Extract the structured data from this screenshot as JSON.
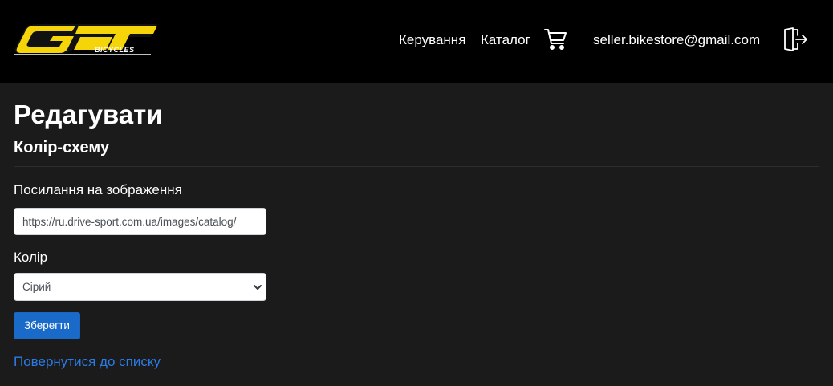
{
  "header": {
    "logo_text": "GT",
    "logo_subtext": "BICYCLES",
    "nav_manage": "Керування",
    "nav_catalog": "Каталог",
    "user_email": "seller.bikestore@gmail.com",
    "cart_icon": "cart-icon",
    "logout_icon": "logout-icon"
  },
  "page": {
    "title": "Редагувати",
    "subtitle": "Колір-схему"
  },
  "form": {
    "image_label": "Посилання на зображення",
    "image_value": "https://ru.drive-sport.com.ua/images/catalog/",
    "color_label": "Колір",
    "color_selected": "Сірий",
    "save_label": "Зберегти"
  },
  "back_link": "Повернутися до списку",
  "colors": {
    "navbar_bg": "#000000",
    "page_bg": "#1b1b1b",
    "logo_yellow": "#f5d50a",
    "primary": "#1a6ac9",
    "link": "#2a7be8"
  }
}
